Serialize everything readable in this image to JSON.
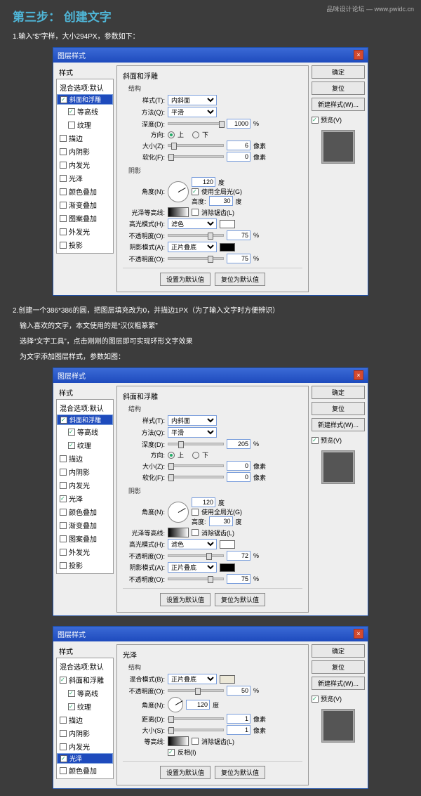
{
  "watermark": "品味设计论坛 — www.pwidc.cn",
  "step": {
    "prefix": "第三步：",
    "title": "创建文字"
  },
  "intro1": "1.输入“$”字样，大小294PX，参数如下：",
  "intro2_lines": [
    "2.创建一个386*386的圆，把图层填充改为0，并描边1PX（为了输入文字时方便辨识）",
    "输入喜欢的文字，本文使用的是“汉仪粗篆繁”",
    "选择“文字工具”，点击刚刚的图层即可实现环形文字效果",
    "为文字添加图层样式，参数如图："
  ],
  "dlg_title": "图层样式",
  "left_header": "样式",
  "blend_default": "混合选项:默认",
  "effects": {
    "bevel": "斜面和浮雕",
    "contour": "等高线",
    "texture": "纹理",
    "stroke": "描边",
    "innershadow": "内阴影",
    "innerglow": "内发光",
    "satin": "光泽",
    "color": "颜色叠加",
    "gradient": "渐变叠加",
    "pattern": "图案叠加",
    "outerglow": "外发光",
    "drop": "投影"
  },
  "btn": {
    "ok": "确定",
    "cancel": "复位",
    "new": "新建样式(W)...",
    "preview": "预览(V)",
    "makedef": "设置为默认值",
    "resetdef": "复位为默认值"
  },
  "bevel": {
    "title": "斜面和浮雕",
    "struct": "结构",
    "style_lbl": "样式(T):",
    "style_val": "内斜面",
    "method_lbl": "方法(Q):",
    "method_val": "平滑",
    "depth_lbl": "深度(D):",
    "dir_lbl": "方向:",
    "up": "上",
    "down": "下",
    "size_lbl": "大小(Z):",
    "soft_lbl": "软化(F):",
    "px": "像素",
    "pct": "%",
    "shade": "阴影",
    "angle_lbl": "角度(N):",
    "deg": "度",
    "global": "使用全局光(G)",
    "alt_lbl": "高度:",
    "gloss_lbl": "光泽等高线:",
    "antialias": "消除锯齿(L)",
    "hilite_lbl": "高光模式(H):",
    "screen": "滤色",
    "opac_lbl": "不透明度(O):",
    "shadow_lbl": "阴影模式(A):",
    "multiply": "正片叠底"
  },
  "d1": {
    "depth": "1000",
    "size": "6",
    "soft": "0",
    "angle": "120",
    "alt": "30",
    "hop": "75",
    "sop": "75"
  },
  "d2": {
    "depth": "205",
    "size": "0",
    "soft": "0",
    "angle": "120",
    "alt": "30",
    "hop": "72",
    "sop": "75"
  },
  "satin": {
    "title": "光泽",
    "struct": "结构",
    "blend_lbl": "混合模式(B):",
    "multiply": "正片叠底",
    "opac_lbl": "不透明度(O):",
    "opac": "50",
    "angle_lbl": "角度(N):",
    "angle": "120",
    "deg": "度",
    "dist_lbl": "距离(D):",
    "dist": "1",
    "px": "像素",
    "size_lbl": "大小(S):",
    "size": "1",
    "contour_lbl": "等高线:",
    "antialias": "消除锯齿(L)",
    "invert": "反相(I)"
  }
}
